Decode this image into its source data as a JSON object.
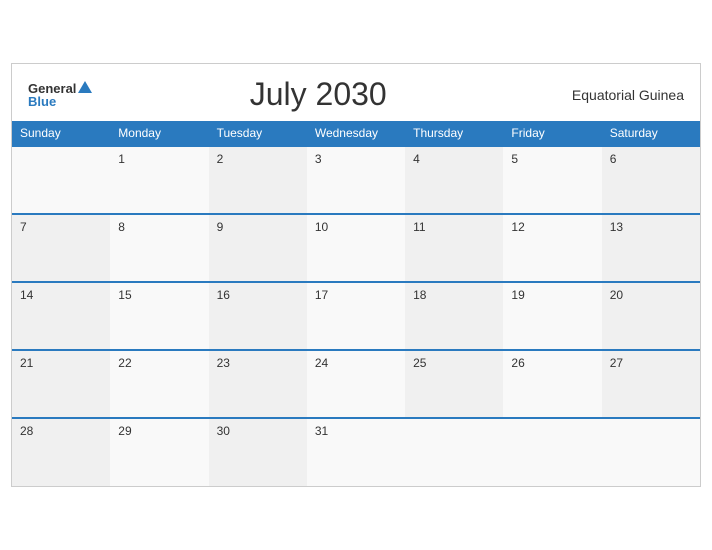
{
  "header": {
    "logo_general": "General",
    "logo_blue": "Blue",
    "month_title": "July 2030",
    "country": "Equatorial Guinea"
  },
  "weekdays": [
    "Sunday",
    "Monday",
    "Tuesday",
    "Wednesday",
    "Thursday",
    "Friday",
    "Saturday"
  ],
  "weeks": [
    [
      "",
      "1",
      "2",
      "3",
      "4",
      "5",
      "6"
    ],
    [
      "7",
      "8",
      "9",
      "10",
      "11",
      "12",
      "13"
    ],
    [
      "14",
      "15",
      "16",
      "17",
      "18",
      "19",
      "20"
    ],
    [
      "21",
      "22",
      "23",
      "24",
      "25",
      "26",
      "27"
    ],
    [
      "28",
      "29",
      "30",
      "31",
      "",
      "",
      ""
    ]
  ]
}
